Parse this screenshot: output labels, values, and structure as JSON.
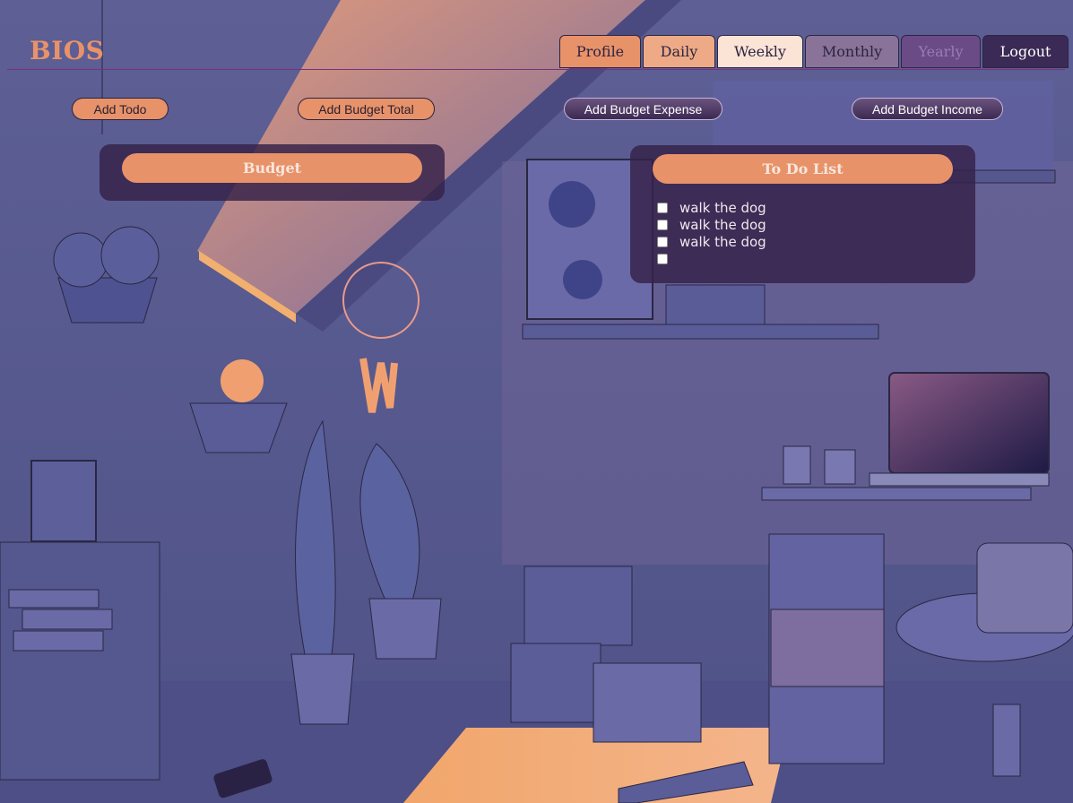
{
  "brand": "BIOS",
  "nav": {
    "tabs": [
      {
        "label": "Profile"
      },
      {
        "label": "Daily"
      },
      {
        "label": "Weekly"
      },
      {
        "label": "Monthly"
      },
      {
        "label": "Yearly"
      },
      {
        "label": "Logout"
      }
    ]
  },
  "actions": {
    "add_todo": "Add Todo",
    "add_budget_total": "Add Budget Total",
    "add_budget_expense": "Add Budget Expense",
    "add_budget_income": "Add Budget Income"
  },
  "budget": {
    "title": "Budget"
  },
  "todo": {
    "title": "To Do List",
    "items": [
      {
        "text": "walk the dog",
        "checked": false
      },
      {
        "text": "walk the dog",
        "checked": false
      },
      {
        "text": "walk the dog",
        "checked": false
      },
      {
        "text": "",
        "checked": false
      }
    ]
  },
  "colors": {
    "accent": "#e8926a",
    "panel_bg": "#342148",
    "wall": "#585a8f"
  }
}
